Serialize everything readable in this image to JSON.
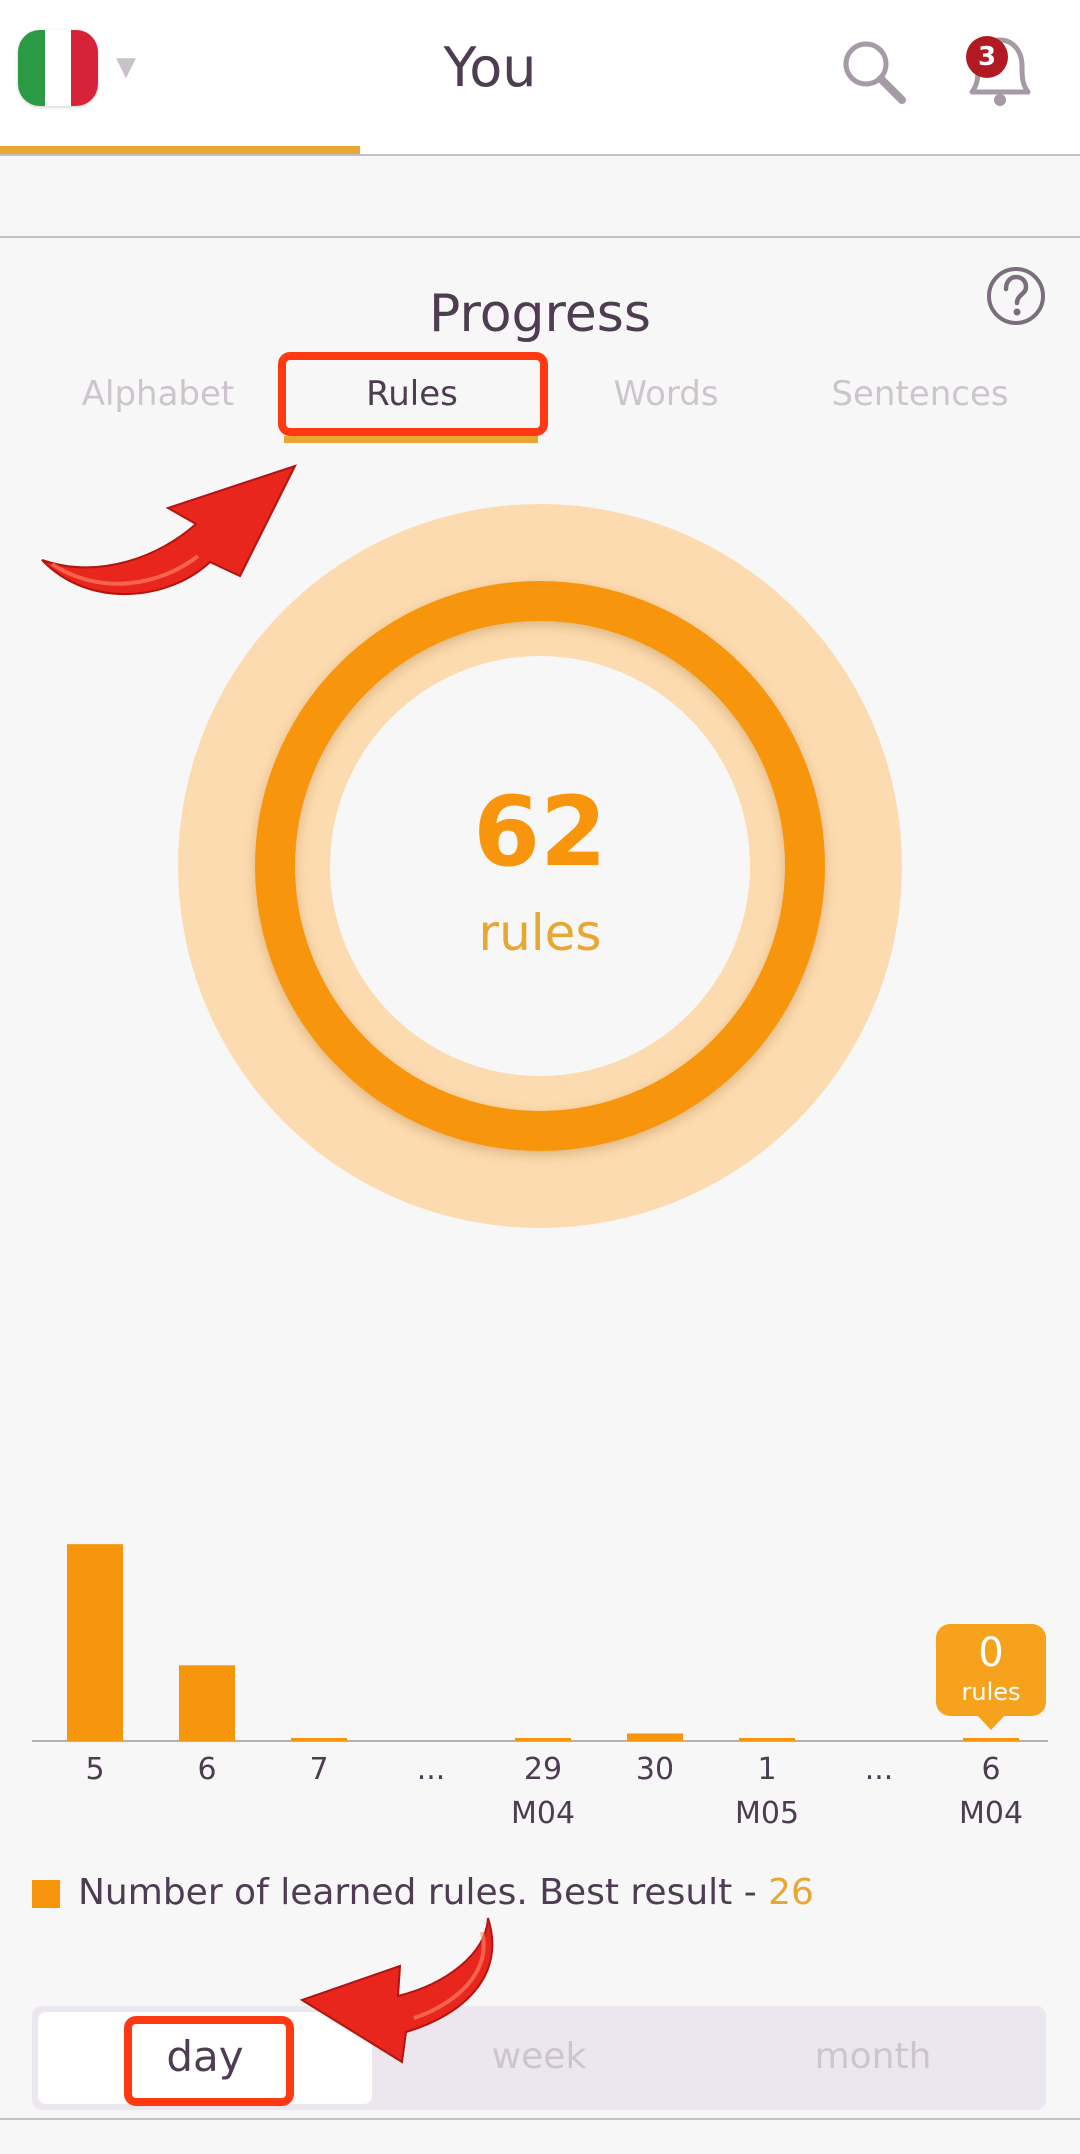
{
  "header": {
    "title": "You",
    "notification_count": "3",
    "flag_colors": [
      "#2b9a42",
      "#ffffff",
      "#d6233a"
    ]
  },
  "progress": {
    "title": "Progress",
    "tabs": [
      {
        "label": "Alphabet",
        "active": false
      },
      {
        "label": "Rules",
        "active": true
      },
      {
        "label": "Words",
        "active": false
      },
      {
        "label": "Sentences",
        "active": false
      }
    ],
    "ring": {
      "value": "62",
      "unit": "rules"
    }
  },
  "chart_data": {
    "type": "bar",
    "categories": [
      "5",
      "6",
      "7",
      "...",
      "29",
      "30",
      "1",
      "...",
      "6"
    ],
    "month_labels": [
      "",
      "",
      "",
      "",
      "M04",
      "",
      "M05",
      "",
      "M04"
    ],
    "values": [
      26,
      10,
      0.3,
      null,
      0.3,
      1,
      0.3,
      null,
      0.3
    ],
    "ylim": [
      0,
      28
    ],
    "color": "#f7960c",
    "selected": {
      "index": 8,
      "value": "0",
      "unit": "rules"
    },
    "legend": {
      "text": "Number of learned rules. Best result - ",
      "best": "26"
    }
  },
  "period": {
    "options": [
      {
        "label": "day",
        "active": true
      },
      {
        "label": "week",
        "active": false
      },
      {
        "label": "month",
        "active": false
      }
    ]
  },
  "colors": {
    "accent": "#f7960c",
    "accent_light": "#fddbb0",
    "highlight": "#ff3a12",
    "text": "#4e3d52"
  }
}
